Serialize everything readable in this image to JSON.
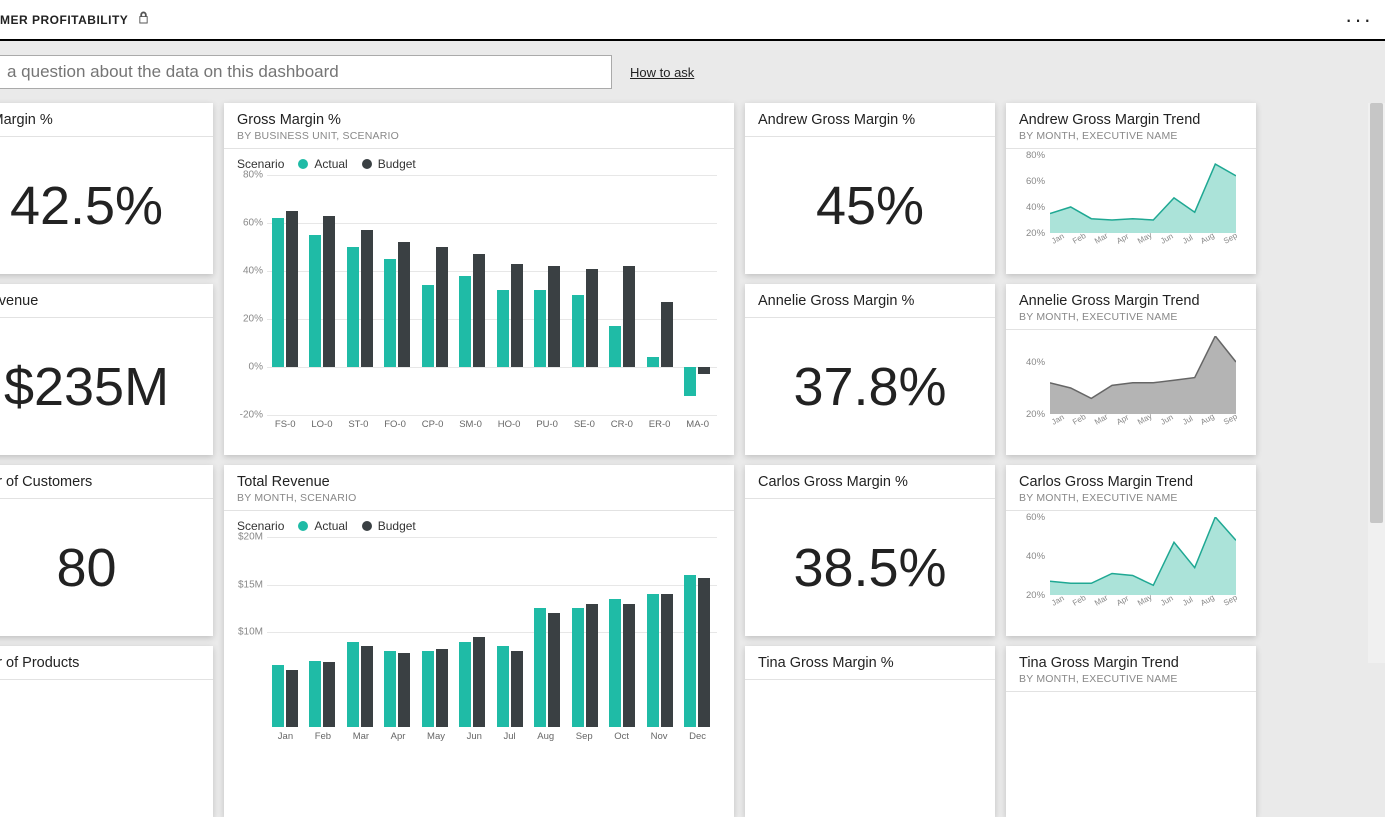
{
  "header": {
    "title_visible": "MER PROFITABILITY"
  },
  "ask": {
    "placeholder": "a question about the data on this dashboard",
    "howto": "How to ask"
  },
  "colors": {
    "actual": "#1fbba6",
    "budget": "#3a4043",
    "grey_series": "#8a8a8a"
  },
  "tiles": {
    "gm_pct_card": {
      "title": "ss Margin %",
      "value": "42.5%"
    },
    "rev_card": {
      "title": "l Revenue",
      "value": "$235M"
    },
    "cust_card": {
      "title": "nber of Customers",
      "value": "80"
    },
    "prod_card": {
      "title": "nber of Products"
    },
    "gm_bar": {
      "title": "Gross Margin %",
      "subtitle": "BY BUSINESS UNIT, SCENARIO",
      "legend_label": "Scenario",
      "legend_actual": "Actual",
      "legend_budget": "Budget"
    },
    "rev_bar": {
      "title": "Total Revenue",
      "subtitle": "BY MONTH, SCENARIO",
      "legend_label": "Scenario",
      "legend_actual": "Actual",
      "legend_budget": "Budget"
    },
    "andrew_gm": {
      "title": "Andrew Gross Margin %",
      "value": "45%"
    },
    "annelie_gm": {
      "title": "Annelie Gross Margin %",
      "value": "37.8%"
    },
    "carlos_gm": {
      "title": "Carlos Gross Margin %",
      "value": "38.5%"
    },
    "tina_gm": {
      "title": "Tina Gross Margin %"
    },
    "andrew_trend": {
      "title": "Andrew Gross Margin Trend",
      "subtitle": "BY MONTH, EXECUTIVE NAME"
    },
    "annelie_trend": {
      "title": "Annelie Gross Margin Trend",
      "subtitle": "BY MONTH, EXECUTIVE NAME"
    },
    "carlos_trend": {
      "title": "Carlos Gross Margin Trend",
      "subtitle": "BY MONTH, EXECUTIVE NAME"
    },
    "tina_trend": {
      "title": "Tina Gross Margin Trend",
      "subtitle": "BY MONTH, EXECUTIVE NAME"
    }
  },
  "chart_data": [
    {
      "id": "gm_bar",
      "type": "bar",
      "title": "Gross Margin %",
      "subtitle": "BY BUSINESS UNIT, SCENARIO",
      "categories": [
        "FS-0",
        "LO-0",
        "ST-0",
        "FO-0",
        "CP-0",
        "SM-0",
        "HO-0",
        "PU-0",
        "SE-0",
        "CR-0",
        "ER-0",
        "MA-0"
      ],
      "series": [
        {
          "name": "Actual",
          "values": [
            62,
            55,
            50,
            45,
            34,
            38,
            32,
            32,
            30,
            17,
            4,
            -12
          ]
        },
        {
          "name": "Budget",
          "values": [
            65,
            63,
            57,
            52,
            50,
            47,
            43,
            42,
            41,
            42,
            27,
            -3
          ]
        }
      ],
      "ylabel": "",
      "xlabel": "",
      "ylim": [
        -20,
        80
      ],
      "yticks": [
        -20,
        0,
        20,
        40,
        60,
        80
      ],
      "ytick_labels": [
        "-20%",
        "0%",
        "20%",
        "40%",
        "60%",
        "80%"
      ]
    },
    {
      "id": "rev_bar",
      "type": "bar",
      "title": "Total Revenue",
      "subtitle": "BY MONTH, SCENARIO",
      "categories": [
        "Jan",
        "Feb",
        "Mar",
        "Apr",
        "May",
        "Jun",
        "Jul",
        "Aug",
        "Sep",
        "Oct",
        "Nov",
        "Dec"
      ],
      "series": [
        {
          "name": "Actual",
          "values": [
            6.5,
            7.0,
            9.0,
            8.0,
            8.0,
            9.0,
            8.5,
            12.5,
            12.5,
            13.5,
            14.0,
            16.0
          ]
        },
        {
          "name": "Budget",
          "values": [
            6.0,
            6.8,
            8.5,
            7.8,
            8.2,
            9.5,
            8.0,
            12.0,
            13.0,
            13.0,
            14.0,
            15.7
          ]
        }
      ],
      "ylabel": "",
      "xlabel": "",
      "ylim": [
        0,
        20
      ],
      "yticks": [
        10,
        15,
        20
      ],
      "ytick_labels": [
        "$10M",
        "$15M",
        "$20M"
      ]
    },
    {
      "id": "andrew_trend",
      "type": "area",
      "title": "Andrew Gross Margin Trend",
      "categories": [
        "Jan",
        "Feb",
        "Mar",
        "Apr",
        "May",
        "Jun",
        "Jul",
        "Aug",
        "Sep"
      ],
      "series": [
        {
          "name": "Andrew",
          "values": [
            35,
            40,
            31,
            30,
            31,
            30,
            47,
            36,
            73,
            64
          ]
        }
      ],
      "ylim": [
        20,
        80
      ],
      "yticks": [
        20,
        40,
        60,
        80
      ],
      "ytick_labels": [
        "20%",
        "40%",
        "60%",
        "80%"
      ],
      "color": "#8fd9cc"
    },
    {
      "id": "annelie_trend",
      "type": "area",
      "title": "Annelie Gross Margin Trend",
      "categories": [
        "Jan",
        "Feb",
        "Mar",
        "Apr",
        "May",
        "Jun",
        "Jul",
        "Aug",
        "Sep"
      ],
      "series": [
        {
          "name": "Annelie",
          "values": [
            32,
            30,
            26,
            31,
            32,
            32,
            33,
            34,
            50,
            40
          ]
        }
      ],
      "ylim": [
        20,
        50
      ],
      "yticks": [
        20,
        40
      ],
      "ytick_labels": [
        "20%",
        "40%"
      ],
      "color": "#9b9b9b"
    },
    {
      "id": "carlos_trend",
      "type": "area",
      "title": "Carlos Gross Margin Trend",
      "categories": [
        "Jan",
        "Feb",
        "Mar",
        "Apr",
        "May",
        "Jun",
        "Jul",
        "Aug",
        "Sep"
      ],
      "series": [
        {
          "name": "Carlos",
          "values": [
            27,
            26,
            26,
            31,
            30,
            25,
            47,
            34,
            60,
            48
          ]
        }
      ],
      "ylim": [
        20,
        60
      ],
      "yticks": [
        20,
        40,
        60
      ],
      "ytick_labels": [
        "20%",
        "40%",
        "60%"
      ],
      "color": "#8fd9cc"
    }
  ]
}
